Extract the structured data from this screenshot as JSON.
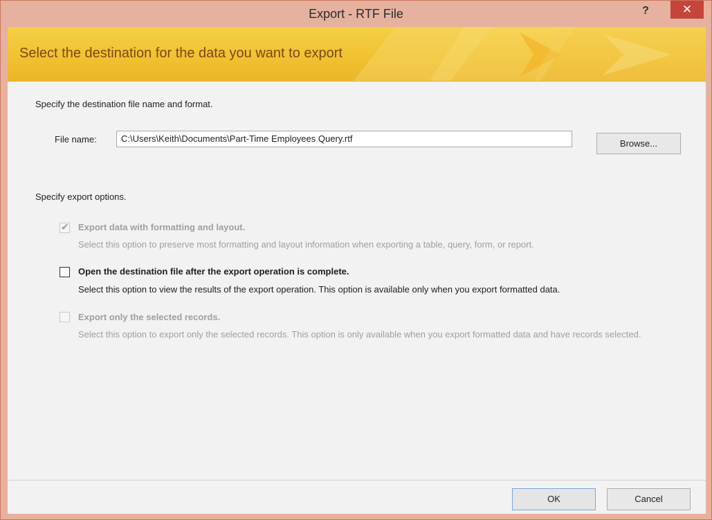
{
  "window": {
    "title": "Export - RTF File",
    "help_label": "?",
    "close_label": "✕"
  },
  "banner": {
    "text": "Select the destination for the data you want to export"
  },
  "destination": {
    "heading": "Specify the destination file name and format.",
    "file_name_label": "File name:",
    "file_name_value": "C:\\Users\\Keith\\Documents\\Part-Time Employees Query.rtf",
    "browse_label": "Browse..."
  },
  "options": {
    "heading": "Specify export options.",
    "items": [
      {
        "title": "Export data with formatting and layout.",
        "description": "Select this option to preserve most formatting and layout information when exporting a table, query, form, or report.",
        "checked": true,
        "enabled": false
      },
      {
        "title": "Open the destination file after the export operation is complete.",
        "description": "Select this option to view the results of the export operation. This option is available only when you export formatted data.",
        "checked": false,
        "enabled": true
      },
      {
        "title": "Export only the selected records.",
        "description": "Select this option to export only the selected records. This option is only available when you export formatted data and have records selected.",
        "checked": false,
        "enabled": false
      }
    ]
  },
  "footer": {
    "ok_label": "OK",
    "cancel_label": "Cancel"
  },
  "colors": {
    "title_bar": "#e6b29f",
    "close_button": "#c7443a",
    "banner": "#f1c232",
    "banner_text": "#7a4a12",
    "body": "#f2f2f2"
  }
}
